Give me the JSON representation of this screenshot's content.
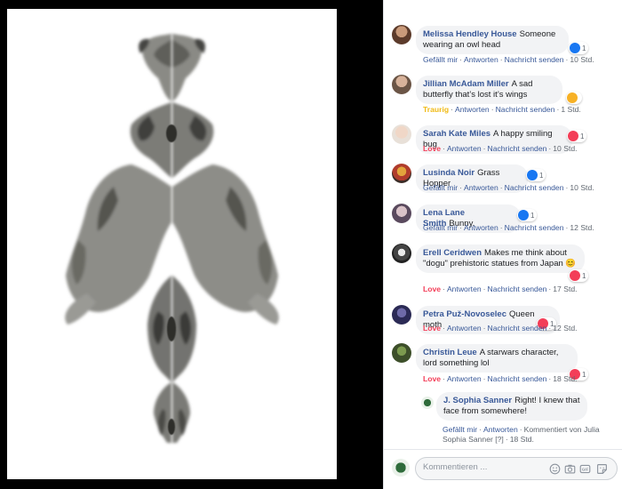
{
  "comments": [
    {
      "author": "Melissa Hendley House",
      "text": "Someone wearing an owl head",
      "reaction_label": "Gefällt mir",
      "reply": "Antworten",
      "message": "Nachricht senden",
      "time": "10 Std.",
      "badge": "1",
      "badge_icon": "like-icon"
    },
    {
      "author": "Jillian McAdam Miller",
      "text": "A sad butterfly that’s lost it’s wings",
      "reaction_label": "Traurig",
      "reply": "Antworten",
      "message": "Nachricht senden",
      "time": "1 Std.",
      "badge": "",
      "badge_icon": "sad-face-icon"
    },
    {
      "author": "Sarah Kate Miles",
      "text": "A happy smiling bug",
      "reaction_label": "Love",
      "reply": "Antworten",
      "message": "Nachricht senden",
      "time": "10 Std.",
      "badge": "1",
      "badge_icon": "heart-icon"
    },
    {
      "author": "Lusinda Noir",
      "text": "Grass Hopper",
      "reaction_label": "Gefällt mir",
      "reply": "Antworten",
      "message": "Nachricht senden",
      "time": "10 Std.",
      "badge": "1",
      "badge_icon": "like-icon"
    },
    {
      "author": "Lena Lane Smith",
      "text": "Bunny.",
      "reaction_label": "Gefällt mir",
      "reply": "Antworten",
      "message": "Nachricht senden",
      "time": "12 Std.",
      "badge": "1",
      "badge_icon": "like-icon"
    },
    {
      "author": "Erell Ceridwen",
      "text": "Makes me think about \"dogu\" prehistoric statues from Japan 😊",
      "reaction_label": "Love",
      "reply": "Antworten",
      "message": "Nachricht senden",
      "time": "17 Std.",
      "badge": "1",
      "badge_icon": "heart-icon"
    },
    {
      "author": "Petra Puž-Novoselec",
      "text": "Queen moth",
      "reaction_label": "Love",
      "reply": "Antworten",
      "message": "Nachricht senden",
      "time": "12 Std.",
      "badge": "1",
      "badge_icon": "heart-icon"
    },
    {
      "author": "Christin Leue",
      "text": "A starwars character, lord something lol",
      "reaction_label": "Love",
      "reply": "Antworten",
      "message": "Nachricht senden",
      "time": "18 Std.",
      "badge": "1",
      "badge_icon": "heart-icon"
    }
  ],
  "reply": {
    "author": "J. Sophia Sanner",
    "text": "Right! I knew that face from somewhere!",
    "reaction_label": "Gefällt mir",
    "reply": "Antworten",
    "edited_by": "Kommentiert von Julia Sophia Sanner",
    "edited_mark": "[?]",
    "time": "18 Std."
  },
  "composer": {
    "placeholder": "Kommentieren ..."
  },
  "colors": {
    "link": "#385898",
    "love": "#f33e58",
    "sad": "#f0ba15",
    "like": "#1877f2",
    "bubble": "#f2f3f5"
  }
}
